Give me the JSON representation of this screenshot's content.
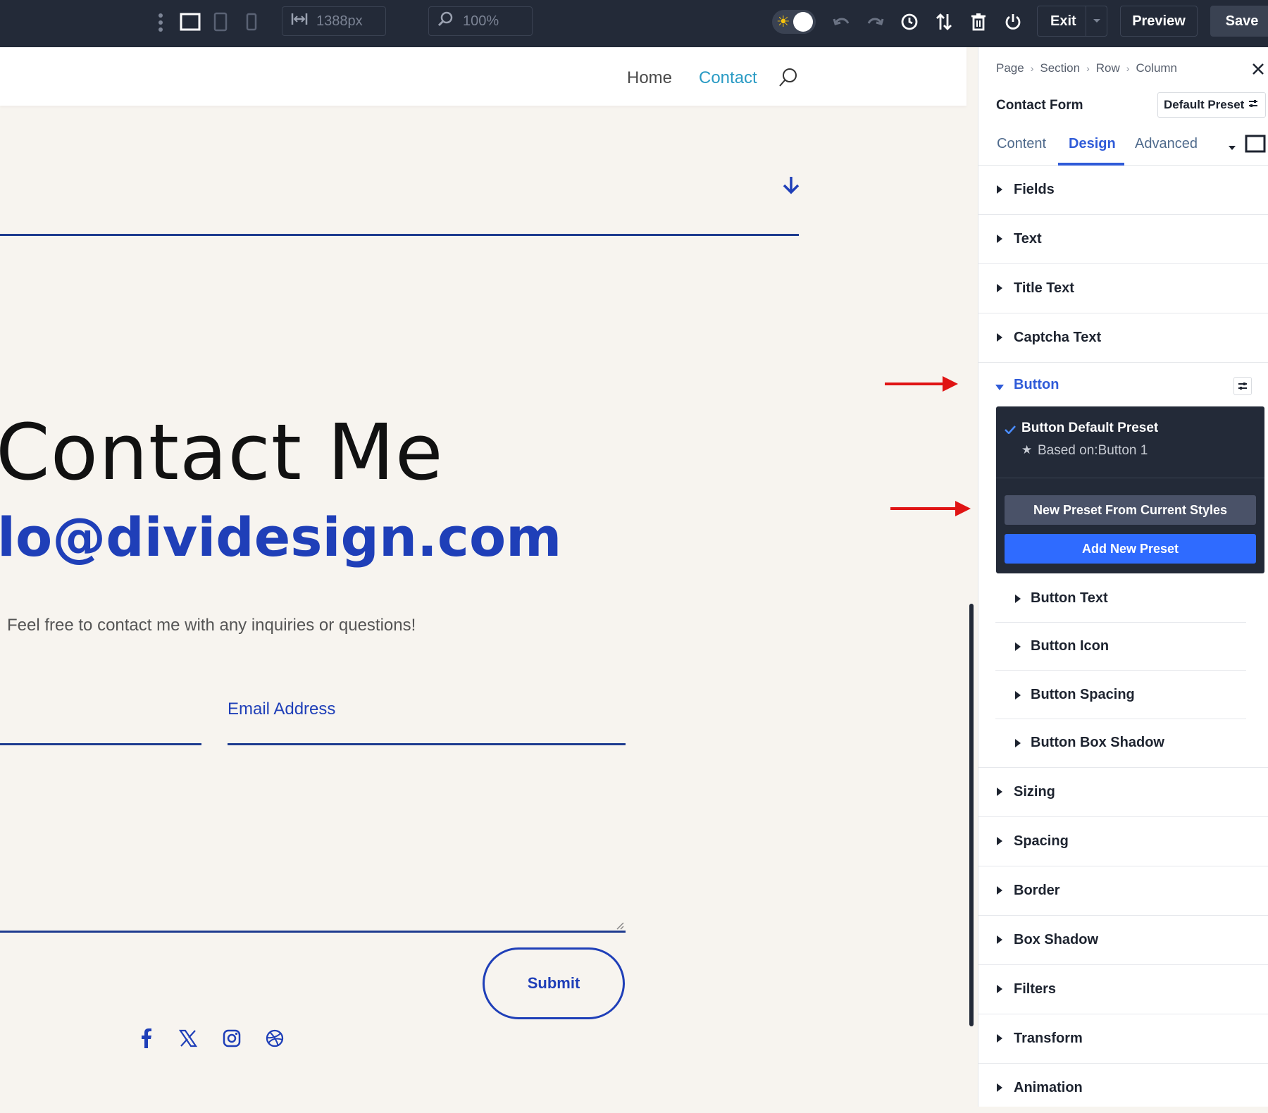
{
  "topbar": {
    "width_value": "1388px",
    "zoom_value": "100%",
    "exit_label": "Exit",
    "preview_label": "Preview",
    "save_label": "Save"
  },
  "site": {
    "nav": [
      "Home",
      "Contact"
    ],
    "heading": "Contact Me",
    "email": "lo@dividesign.com",
    "intro": "Feel free to contact me with any inquiries or questions!",
    "email_field_placeholder": "Email Address",
    "submit_label": "Submit"
  },
  "panel": {
    "breadcrumb": [
      "Page",
      "Section",
      "Row",
      "Column"
    ],
    "module_title": "Contact Form",
    "preset_label": "Default Preset",
    "tabs": [
      "Content",
      "Design",
      "Advanced"
    ],
    "active_tab": "Design",
    "groups_top": [
      "Fields",
      "Text",
      "Title Text",
      "Captcha Text"
    ],
    "open_group": "Button",
    "preset_dropdown": {
      "current_name": "Button Default Preset",
      "based_on": "Based on:Button 1",
      "new_from_current": "New Preset From Current Styles",
      "add_new": "Add New Preset"
    },
    "button_subgroups": [
      "Button Text",
      "Button Icon",
      "Button Spacing",
      "Button Box Shadow"
    ],
    "groups_bottom": [
      "Sizing",
      "Spacing",
      "Border",
      "Box Shadow",
      "Filters",
      "Transform",
      "Animation"
    ]
  },
  "colors": {
    "topbar_bg": "#232a38",
    "accent_blue": "#2f5bd8",
    "site_blue": "#1f3fb8",
    "nav_active": "#2a9bc4",
    "annotation_red": "#e01414"
  }
}
